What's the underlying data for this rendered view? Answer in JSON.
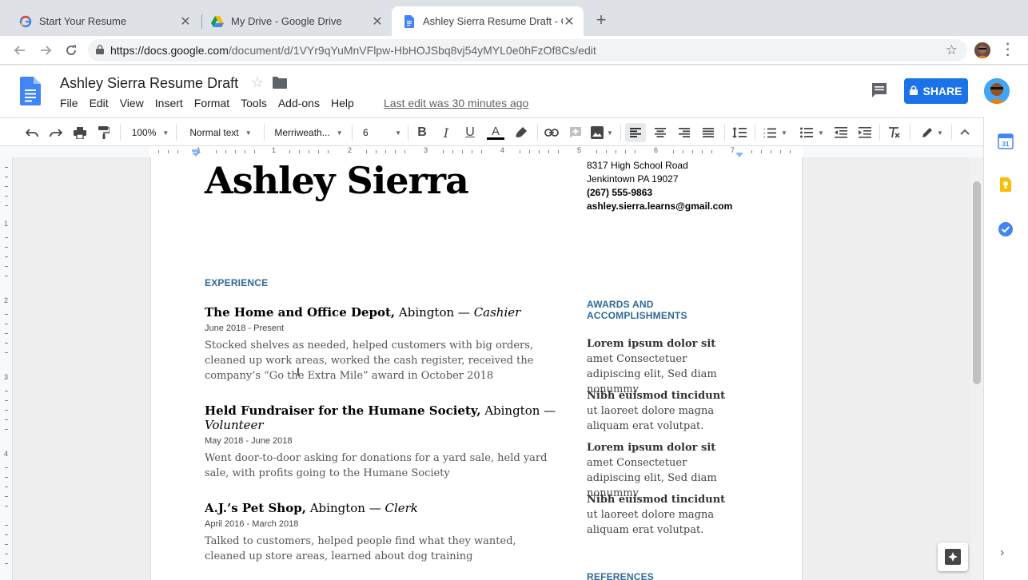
{
  "browser": {
    "tabs": [
      {
        "title": "Start Your Resume",
        "icon": "google-g-icon",
        "active": false
      },
      {
        "title": "My Drive - Google Drive",
        "icon": "google-drive-icon",
        "active": false
      },
      {
        "title": "Ashley Sierra Resume Draft - G",
        "icon": "google-docs-icon",
        "active": true
      }
    ],
    "new_tab": "+",
    "url_host": "https://docs.google.com",
    "url_path": "/document/d/1VYr9qYuMnVFlpw-HbHOJSbq8vj54yMYL0e0hFzOf8Cs/edit",
    "close_glyph": "✕"
  },
  "docs": {
    "title": "Ashley Sierra Resume Draft",
    "menu": [
      "File",
      "Edit",
      "View",
      "Insert",
      "Format",
      "Tools",
      "Add-ons",
      "Help"
    ],
    "last_edit": "Last edit was 30 minutes ago",
    "share_label": "SHARE",
    "accent": "#1a73e8"
  },
  "toolbar": {
    "zoom": "100%",
    "style": "Normal text",
    "font": "Merriweath...",
    "size": "6"
  },
  "ruler": {
    "h_numbers": [
      "1",
      "1",
      "2",
      "3",
      "4",
      "5",
      "6",
      "7"
    ],
    "v_numbers": [
      "1",
      "2",
      "3",
      "4"
    ]
  },
  "resume": {
    "name": "Ashley Sierra",
    "address1": "8317 High School Road",
    "address2": "Jenkintown PA 19027",
    "phone": "(267) 555-9863",
    "email": "ashley.sierra.learns@gmail.com",
    "experience_heading": "EXPERIENCE",
    "awards_heading_1": "AWARDS AND",
    "awards_heading_2": "ACCOMPLISHMENTS",
    "references_heading": "REFERENCES",
    "heading_color": "#2e6a99",
    "jobs": [
      {
        "org": "The Home and Office Depot,",
        "location": " Abington — ",
        "role": "Cashier",
        "dates": "June 2018 - Present",
        "desc": "Stocked shelves as needed, helped customers with big orders, cleaned up work areas, worked the cash register, received the company’s “Go the Extra Mile” award in October 2018"
      },
      {
        "org": "Held Fundraiser for the Humane Society,",
        "location": " Abington — ",
        "role": "Volunteer",
        "dates": "May 2018 - June 2018",
        "desc": "Went door-to-door asking for donations for a yard sale, held yard sale, with profits going to the Humane Society"
      },
      {
        "org": "A.J.’s Pet Shop,",
        "location": " Abington — ",
        "role": "Clerk",
        "dates": "April 2016 - March 2018",
        "desc": "Talked to customers, helped people find what they wanted, cleaned up store areas, learned about dog training"
      }
    ],
    "awards": [
      {
        "bold": "Lorem ipsum dolor sit",
        "rest": " amet Consectetuer adipiscing elit, Sed diam nonummy"
      },
      {
        "bold": "Nibh euismod tincidunt",
        "rest": " ut laoreet dolore magna aliquam erat volutpat."
      },
      {
        "bold": "Lorem ipsum dolor sit",
        "rest": " amet Consectetuer adipiscing elit, Sed diam nonummy"
      },
      {
        "bold": "Nibh euismod tincidunt",
        "rest": " ut laoreet dolore magna aliquam erat volutpat."
      }
    ]
  },
  "sidepanel": {
    "calendar_label": "31",
    "expand_glyph": "›"
  }
}
